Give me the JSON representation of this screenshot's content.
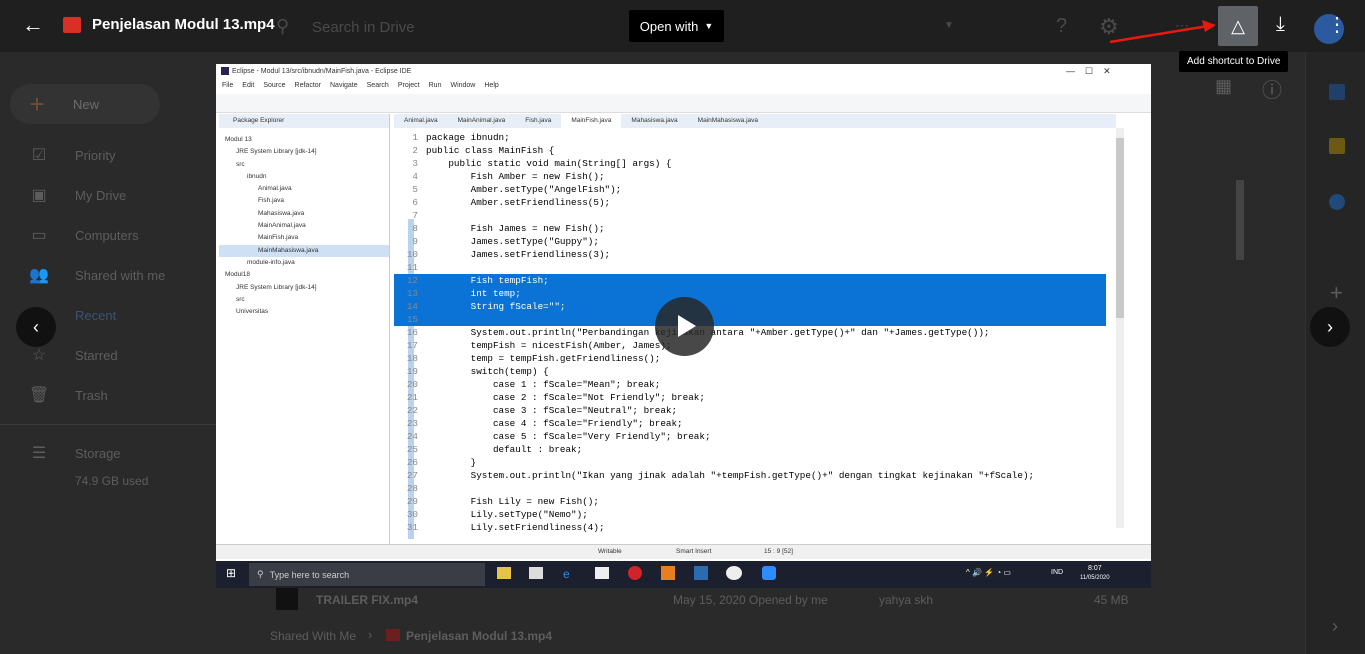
{
  "viewer": {
    "file_title": "Penjelasan Modul 13.mp4",
    "open_with": "Open with",
    "tooltip": "Add shortcut to Drive"
  },
  "drive_bg": {
    "search_placeholder": "Search in Drive",
    "new_label": "New",
    "nav": [
      "Priority",
      "My Drive",
      "Computers",
      "Shared with me",
      "Recent",
      "Starred",
      "Trash"
    ],
    "storage_label": "Storage",
    "storage_used": "74.9 GB used",
    "file_row": {
      "name": "TRAILER FIX.mp4",
      "date": "May 15, 2020 Opened by me",
      "owner": "yahya skh",
      "size": "45 MB"
    },
    "breadcrumb": {
      "root": "Shared With Me",
      "file": "Penjelasan Modul 13.mp4"
    }
  },
  "ide": {
    "title": "Eclipse - Modul 13/src/ibnudn/MainFish.java - Eclipse IDE",
    "menu": [
      "File",
      "Edit",
      "Source",
      "Refactor",
      "Navigate",
      "Search",
      "Project",
      "Run",
      "Window",
      "Help"
    ],
    "package_explorer": "Package Explorer",
    "tree": [
      "Modul 13",
      "JRE System Library [jdk-14]",
      "src",
      "ibnudn",
      "Animal.java",
      "Fish.java",
      "Mahasiswa.java",
      "MainAnimal.java",
      "MainFish.java",
      "MainMahasiswa.java",
      "module-info.java",
      "Modul18",
      "JRE System Library [jdk-14]",
      "src",
      "Universitas"
    ],
    "tabs": [
      "Animal.java",
      "MainAnimal.java",
      "Fish.java",
      "MainFish.java",
      "Mahasiswa.java",
      "MainMahasiswa.java"
    ],
    "code": [
      [
        "1",
        "package ibnudn;"
      ],
      [
        "2",
        "public class MainFish {"
      ],
      [
        "3",
        "    public static void main(String[] args) {"
      ],
      [
        "4",
        "        Fish Amber = new Fish();"
      ],
      [
        "5",
        "        Amber.setType(\"AngelFish\");"
      ],
      [
        "6",
        "        Amber.setFriendliness(5);"
      ],
      [
        "7",
        ""
      ],
      [
        "8",
        "        Fish James = new Fish();"
      ],
      [
        "9",
        "        James.setType(\"Guppy\");"
      ],
      [
        "10",
        "        James.setFriendliness(3);"
      ],
      [
        "11",
        ""
      ],
      [
        "12",
        "        Fish tempFish;"
      ],
      [
        "13",
        "        int temp;"
      ],
      [
        "14",
        "        String fScale=\"\";"
      ],
      [
        "15",
        ""
      ],
      [
        "16",
        "        System.out.println(\"Perbandingan kejinakan antara \"+Amber.getType()+\" dan \"+James.getType());"
      ],
      [
        "17",
        "        tempFish = nicestFish(Amber, James);"
      ],
      [
        "18",
        "        temp = tempFish.getFriendliness();"
      ],
      [
        "19",
        "        switch(temp) {"
      ],
      [
        "20",
        "            case 1 : fScale=\"Mean\"; break;"
      ],
      [
        "21",
        "            case 2 : fScale=\"Not Friendly\"; break;"
      ],
      [
        "22",
        "            case 3 : fScale=\"Neutral\"; break;"
      ],
      [
        "23",
        "            case 4 : fScale=\"Friendly\"; break;"
      ],
      [
        "24",
        "            case 5 : fScale=\"Very Friendly\"; break;"
      ],
      [
        "25",
        "            default : break;"
      ],
      [
        "26",
        "        }"
      ],
      [
        "27",
        "        System.out.println(\"Ikan yang jinak adalah \"+tempFish.getType()+\" dengan tingkat kejinakan \"+fScale);"
      ],
      [
        "28",
        ""
      ],
      [
        "29",
        "        Fish Lily = new Fish();"
      ],
      [
        "30",
        "        Lily.setType(\"Nemo\");"
      ],
      [
        "31",
        "        Lily.setFriendliness(4);"
      ]
    ],
    "status": [
      "Writable",
      "Smart Insert",
      "15 : 9 [52]"
    ],
    "taskbar_search": "Type here to search",
    "clock": "8:07",
    "date": "11/05/2020",
    "lang": "IND"
  },
  "colors": {
    "accent_arrow": "#e8190f",
    "selection": "#0b73d6"
  }
}
